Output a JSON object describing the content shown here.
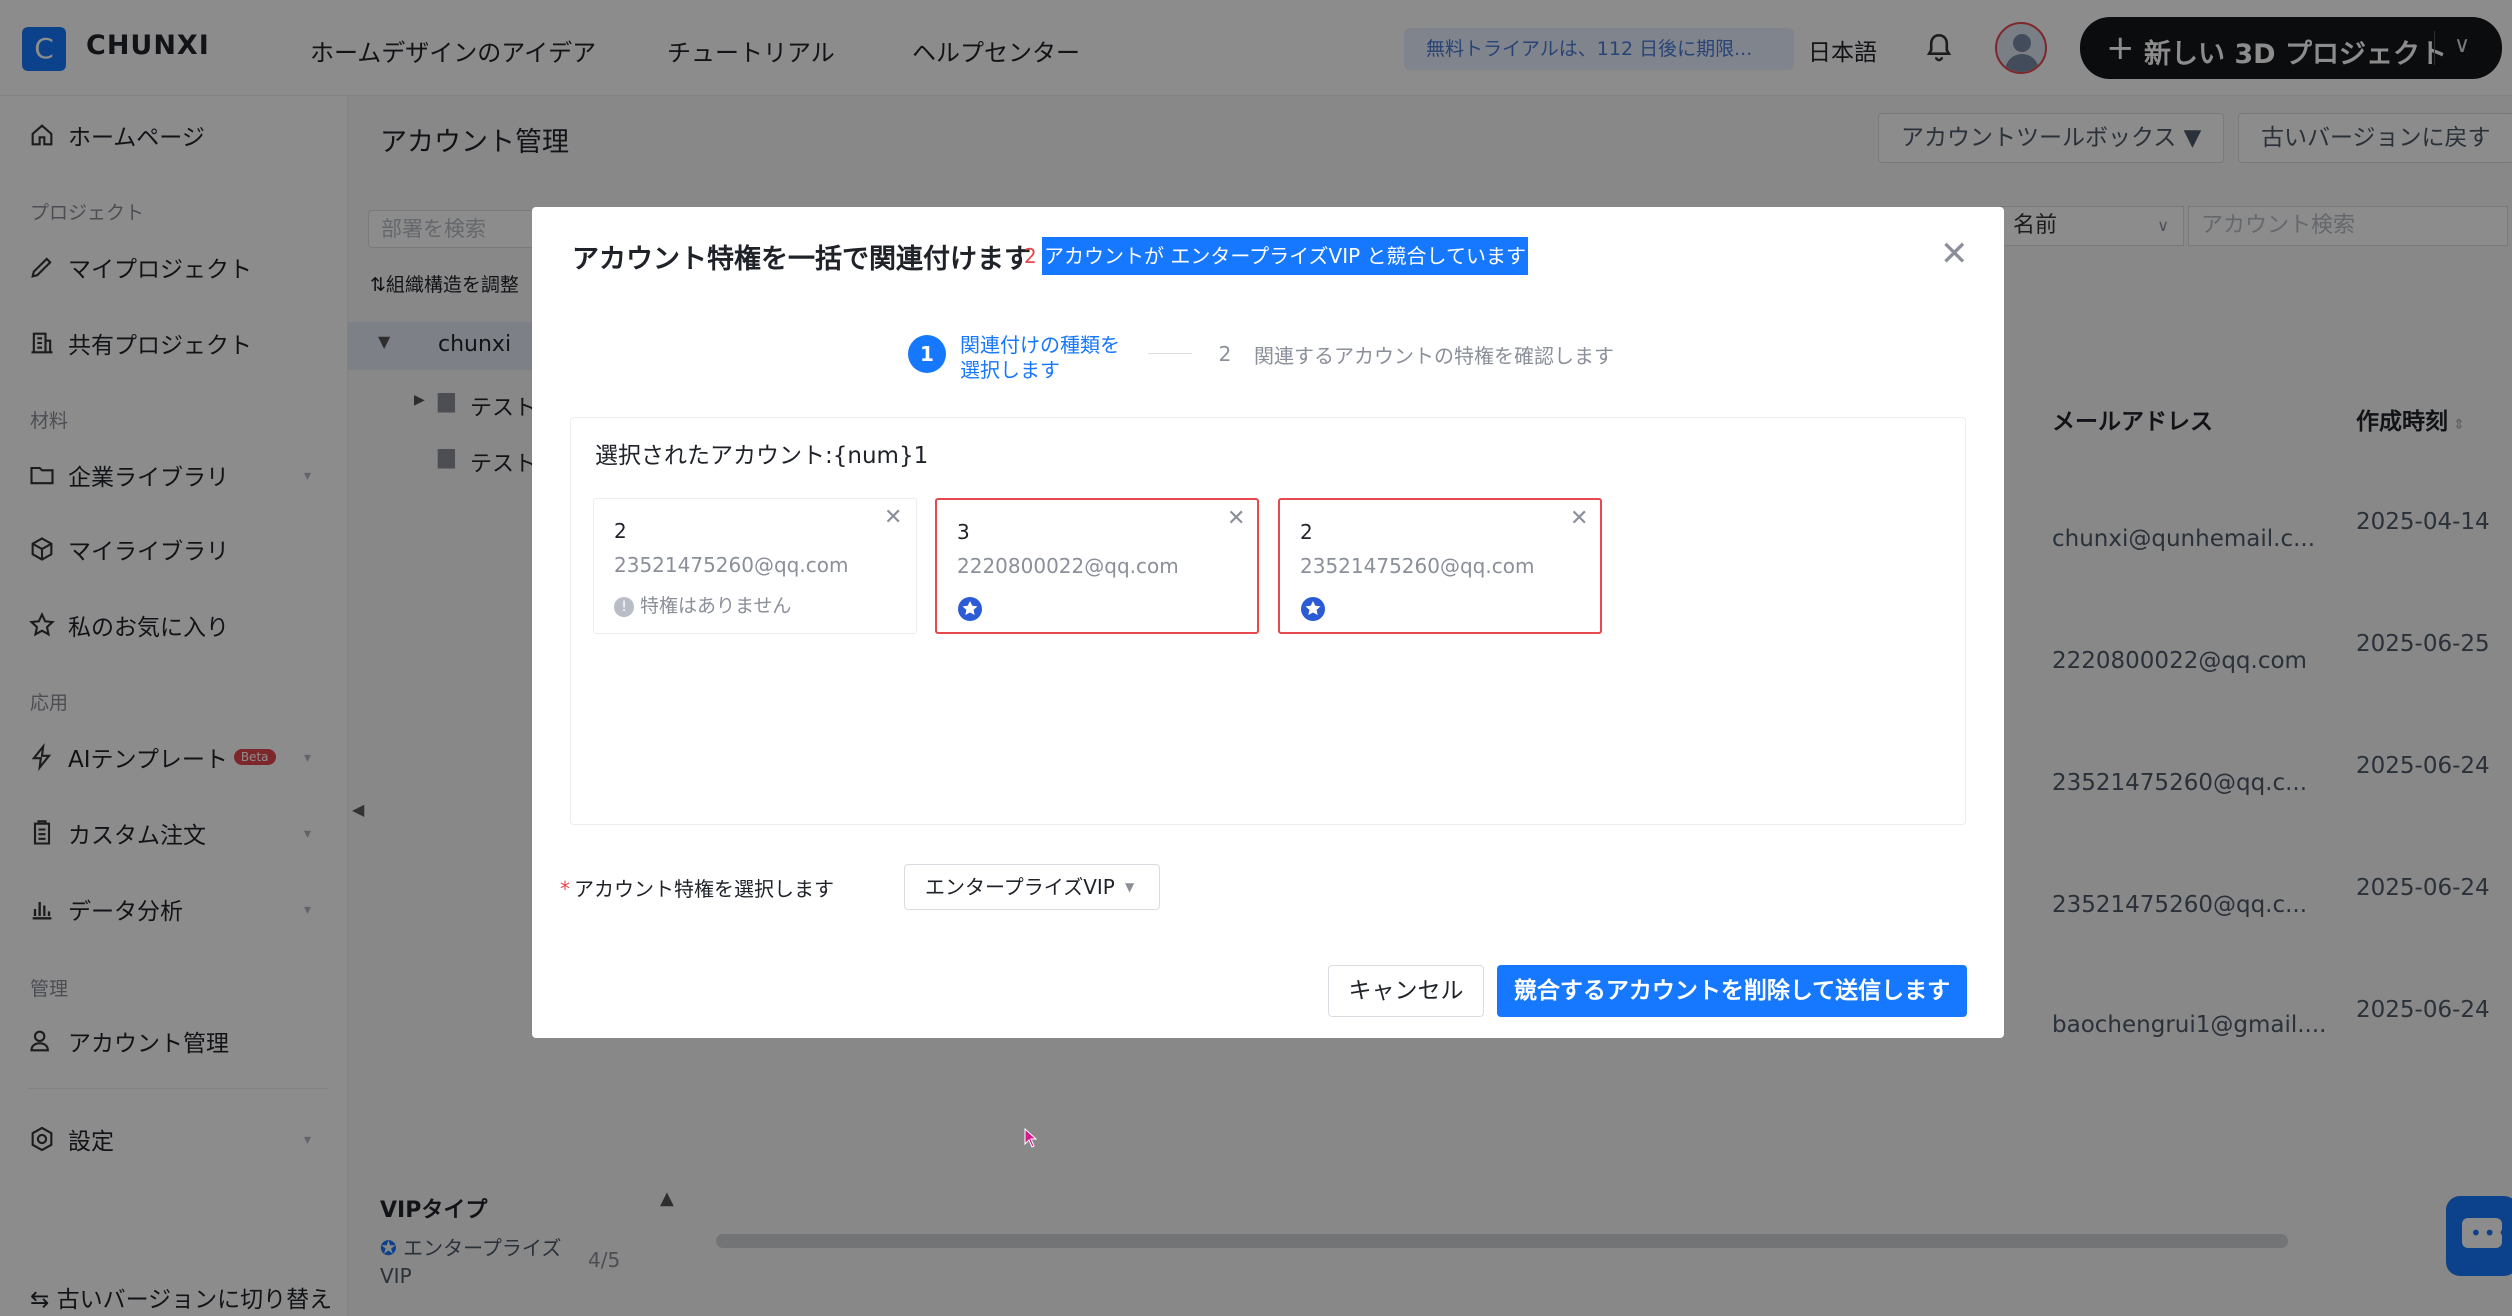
{
  "topbar": {
    "logo_letter": "C",
    "brand": "CHUNXI",
    "nav": [
      "ホームデザインのアイデア",
      "チュートリアル",
      "ヘルプセンター"
    ],
    "trial": "無料トライアルは、112 日後に期限...",
    "language": "日本語",
    "new_project": "新しい 3D プロジェクト"
  },
  "sidebar": {
    "home": "ホームページ",
    "group_project": "プロジェクト",
    "my_projects": "マイプロジェクト",
    "shared_projects": "共有プロジェクト",
    "group_material": "材料",
    "enterprise_library": "企業ライブラリ",
    "my_library": "マイライブラリ",
    "favorites": "私のお気に入り",
    "group_apply": "応用",
    "ai_templates": "AIテンプレート",
    "beta": "Beta",
    "custom_orders": "カスタム注文",
    "data_analysis": "データ分析",
    "group_admin": "管理",
    "account_management": "アカウント管理",
    "settings": "設定",
    "old_version_switch": "古いバージョンに切り替え"
  },
  "main": {
    "title": "アカウント管理",
    "toolbox": "アカウントツールボックス",
    "back_old": "古いバージョンに戻す",
    "dept_search_placeholder": "部署を検索",
    "org_adjust": "組織構造を調整",
    "tree_root": "chunxi",
    "tree_child_1": "テスト",
    "tree_child_2": "テスト",
    "filter_name": "名前",
    "account_search_placeholder": "アカウント検索",
    "col_email": "メールアドレス",
    "col_created": "作成時刻",
    "rows": [
      {
        "email": "chunxi@qunhemail.c...",
        "date": "2025-04-14"
      },
      {
        "email": "2220800022@qq.com",
        "date": "2025-06-25"
      },
      {
        "email": "23521475260@qq.c...",
        "date": "2025-06-24"
      },
      {
        "email": "23521475260@qq.c...",
        "date": "2025-06-24"
      },
      {
        "email": "baochengrui1@gmail....",
        "date": "2025-06-24"
      }
    ],
    "vip_type_title": "VIPタイプ",
    "vip_type_entry": "エンタープライズVIP",
    "vip_type_count": "4/5"
  },
  "modal": {
    "title": "アカウント特権を一括で関連付けます",
    "conflict_count": "2",
    "conflict_message": "アカウントが エンタープライズVIP と競合しています",
    "step1_number": "1",
    "step1_label": "関連付けの種類を選択します",
    "step2_number": "2",
    "step2_label": "関連するアカウントの特権を確認します",
    "selected_accounts": "選択されたアカウント:{num}1",
    "cards": [
      {
        "name": "2",
        "email": "23521475260@qq.com",
        "note": "特権はありません",
        "conflict": false
      },
      {
        "name": "3",
        "email": "2220800022@qq.com",
        "note": "",
        "conflict": true
      },
      {
        "name": "2",
        "email": "23521475260@qq.com",
        "note": "",
        "conflict": true
      }
    ],
    "privilege_label": "アカウント特権を選択します",
    "privilege_value": "エンタープライズVIP",
    "cancel": "キャンセル",
    "submit": "競合するアカウントを削除して送信します"
  },
  "colors": {
    "accent": "#1677ff",
    "conflict": "#e5484d",
    "dark": "#15171a"
  }
}
